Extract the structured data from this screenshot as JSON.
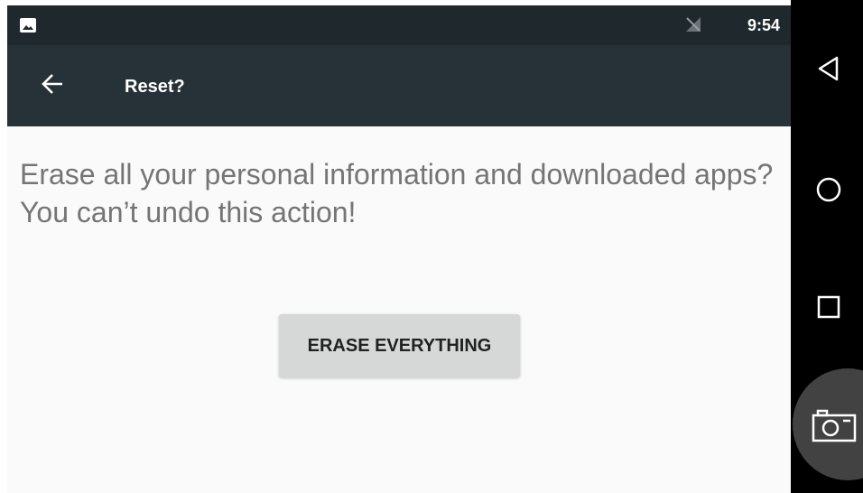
{
  "status_bar": {
    "time": "9:54",
    "left_icon": "image-icon",
    "signal_icon": "no-sim-icon"
  },
  "toolbar": {
    "title": "Reset?",
    "back_icon": "arrow-left-icon"
  },
  "main": {
    "message": "Erase all your personal information and downloaded apps? You can’t undo this action!",
    "erase_button_label": "ERASE EVERYTHING"
  },
  "nav_bar": {
    "icons": [
      "back-triangle-icon",
      "home-circle-icon",
      "recents-square-icon",
      "camera-icon"
    ]
  },
  "colors": {
    "status_bar": "#1e282d",
    "toolbar": "#263238",
    "background": "#fafafa",
    "message_text": "#757575",
    "button": "#d6d7d7",
    "nav_bar": "#000000"
  }
}
